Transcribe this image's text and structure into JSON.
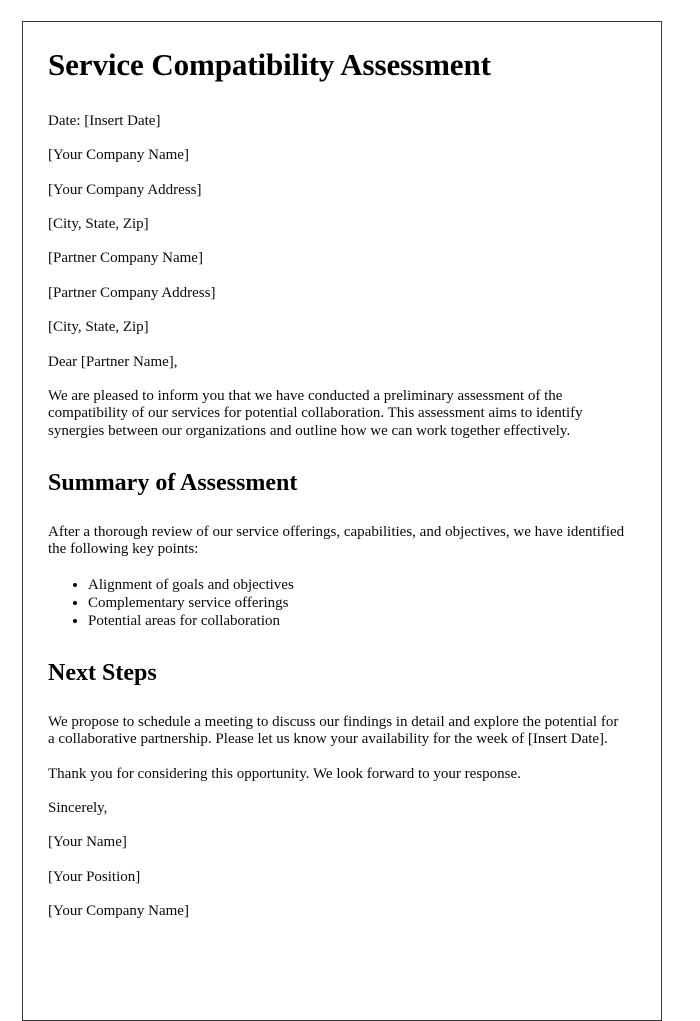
{
  "document": {
    "title": "Service Compatibility Assessment",
    "date_line": "Date: [Insert Date]",
    "sender_address": [
      "[Your Company Name]",
      "[Your Company Address]",
      "[City, State, Zip]"
    ],
    "recipient_address": [
      "[Partner Company Name]",
      "[Partner Company Address]",
      "[City, State, Zip]"
    ],
    "salutation": "Dear [Partner Name],",
    "intro_paragraph": "We are pleased to inform you that we have conducted a preliminary assessment of the compatibility of our services for potential collaboration. This assessment aims to identify synergies between our organizations and outline how we can work together effectively.",
    "sections": [
      {
        "heading": "Summary of Assessment",
        "paragraph": "After a thorough review of our service offerings, capabilities, and objectives, we have identified the following key points:",
        "bullets": [
          "Alignment of goals and objectives",
          "Complementary service offerings",
          "Potential areas for collaboration"
        ]
      },
      {
        "heading": "Next Steps",
        "paragraph": "We propose to schedule a meeting to discuss our findings in detail and explore the potential for a collaborative partnership. Please let us know your availability for the week of [Insert Date]."
      }
    ],
    "closing_paragraph": "Thank you for considering this opportunity. We look forward to your response.",
    "sign_off": "Sincerely,",
    "signature_block": [
      "[Your Name]",
      "[Your Position]",
      "[Your Company Name]"
    ],
    "colors": {
      "text": "#0a0a0a",
      "page_border": "#3a3a3a",
      "page_background": "#ffffff"
    }
  }
}
